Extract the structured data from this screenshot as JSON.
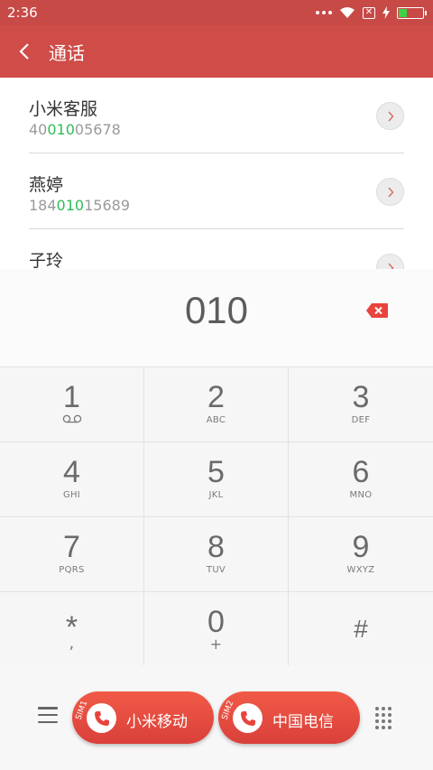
{
  "status_bar": {
    "time": "2:36"
  },
  "header": {
    "title": "通话"
  },
  "contacts": [
    {
      "name": "小米客服",
      "number_pre": "40",
      "number_match": "010",
      "number_post": "05678"
    },
    {
      "name": "燕婷",
      "number_pre": "184",
      "number_match": "010",
      "number_post": "15689"
    },
    {
      "name": "子玲",
      "number_pre": "",
      "number_match": "",
      "number_post": ""
    }
  ],
  "dialer": {
    "number": "010"
  },
  "keypad": [
    {
      "digit": "1",
      "letters": ""
    },
    {
      "digit": "2",
      "letters": "ABC"
    },
    {
      "digit": "3",
      "letters": "DEF"
    },
    {
      "digit": "4",
      "letters": "GHI"
    },
    {
      "digit": "5",
      "letters": "JKL"
    },
    {
      "digit": "6",
      "letters": "MNO"
    },
    {
      "digit": "7",
      "letters": "PQRS"
    },
    {
      "digit": "8",
      "letters": "TUV"
    },
    {
      "digit": "9",
      "letters": "WXYZ"
    },
    {
      "digit": "*",
      "letters": ","
    },
    {
      "digit": "0",
      "letters": "+"
    },
    {
      "digit": "#",
      "letters": ""
    }
  ],
  "calls": [
    {
      "sim": "SIM1",
      "carrier": "小米移动"
    },
    {
      "sim": "SIM2",
      "carrier": "中国电信"
    }
  ],
  "colors": {
    "accent": "#cf4c48",
    "match": "#2ebd56",
    "call_button": "#e84c40"
  }
}
